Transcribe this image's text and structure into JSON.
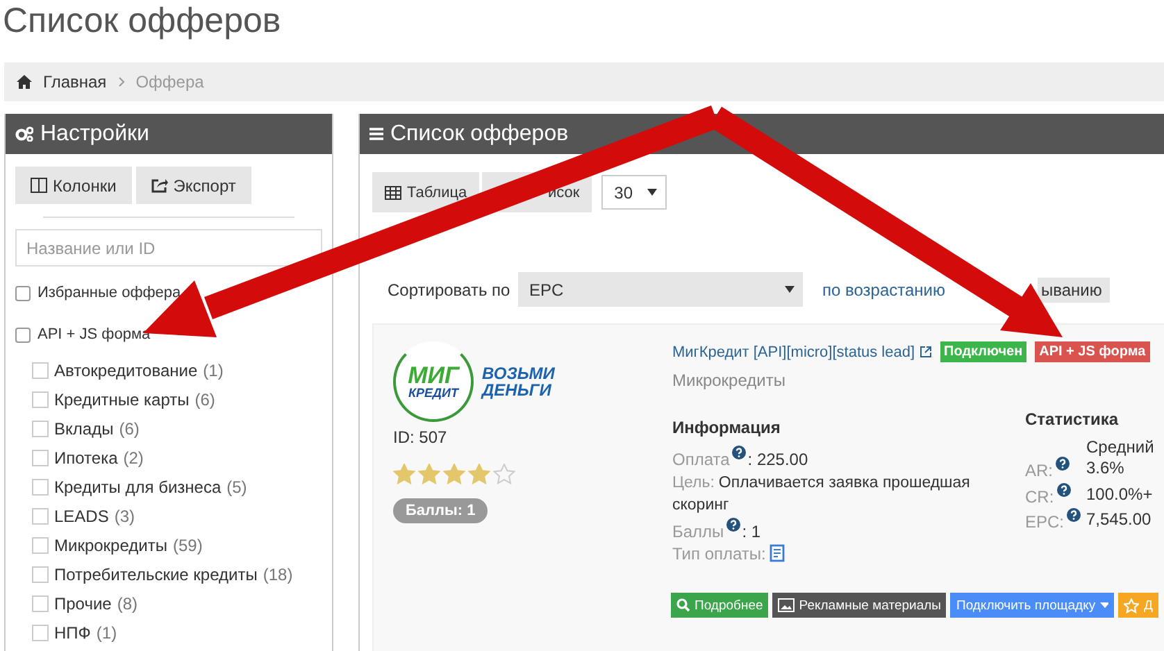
{
  "page_title": "Список офферов",
  "breadcrumb": [
    {
      "label": "Главная",
      "kind": "home"
    },
    {
      "label": "Оффера",
      "kind": "current"
    }
  ],
  "settings": {
    "title": "Настройки",
    "buttons": [
      {
        "label": "Колонки",
        "kind": "columns"
      },
      {
        "label": "Экспорт",
        "kind": "export"
      }
    ],
    "search": {
      "placeholder": "Название или ID"
    },
    "filters": [
      {
        "label": "Избранные оффера",
        "checked": false
      },
      {
        "label": "API + JS форма",
        "checked": false
      }
    ],
    "categories": [
      {
        "label": "Автокредитование",
        "count": "(1)",
        "checked": false
      },
      {
        "label": "Кредитные карты",
        "count": "(6)",
        "checked": false
      },
      {
        "label": "Вклады",
        "count": "(6)",
        "checked": false
      },
      {
        "label": "Ипотека",
        "count": "(2)",
        "checked": false
      },
      {
        "label": "Кредиты для бизнеса",
        "count": "(5)",
        "checked": false
      },
      {
        "label": "LEADS",
        "count": "(3)",
        "checked": false
      },
      {
        "label": "Микрокредиты",
        "count": "(59)",
        "checked": false
      },
      {
        "label": "Потребительские кредиты",
        "count": "(18)",
        "checked": false
      },
      {
        "label": "Прочие",
        "count": "(8)",
        "checked": false
      },
      {
        "label": "НПФ",
        "count": "(1)",
        "checked": false
      }
    ]
  },
  "offers": {
    "title": "Список офферов",
    "views": [
      {
        "label": "Таблица",
        "kind": "table"
      },
      {
        "label": "исок",
        "kind": "list"
      }
    ],
    "per_page": "30",
    "sort": {
      "label": "Сортировать по",
      "value": "EPC",
      "orders": [
        {
          "label": "по возрастанию",
          "selected": false
        },
        {
          "label": "ыванию",
          "selected": true
        }
      ]
    },
    "offer": {
      "logo": {
        "brand": [
          "МИГ",
          "КРЕДИТ"
        ],
        "slogan": [
          "ВОЗЬМИ",
          "ДЕНЬГИ"
        ]
      },
      "id": "ID: 507",
      "stars": 4,
      "score": "Баллы: 1",
      "name": "МигКредит [API][micro][status lead]",
      "badges": [
        {
          "label": "Подключен",
          "color": "#3cb64a"
        },
        {
          "label": "API + JS форма",
          "color": "#d9534f"
        }
      ],
      "category": "Микрокредиты",
      "info_title": "Информация",
      "info": [
        {
          "kind": "help",
          "label": "Оплата",
          "value": ": 225.00"
        },
        {
          "kind": "text",
          "label": "Цель:",
          "value": "Оплачивается заявка прошедшая скоринг"
        },
        {
          "kind": "help",
          "label": "Баллы",
          "value": ": 1"
        },
        {
          "kind": "icon",
          "label": "Тип оплаты:"
        }
      ],
      "stats_title": "Статистика",
      "stats_column": "Средний",
      "stats": [
        {
          "label": "AR:",
          "value": "3.6%"
        },
        {
          "label": "CR:",
          "value": "100.0%+"
        },
        {
          "label": "EPC:",
          "value": "7,545.00"
        }
      ],
      "actions": [
        {
          "label": "Подробнее",
          "kind": "details"
        },
        {
          "label": "Рекламные материалы",
          "kind": "materials"
        },
        {
          "label": "Подключить площадку",
          "kind": "connect"
        },
        {
          "label": "Д",
          "kind": "favorite"
        }
      ]
    }
  }
}
